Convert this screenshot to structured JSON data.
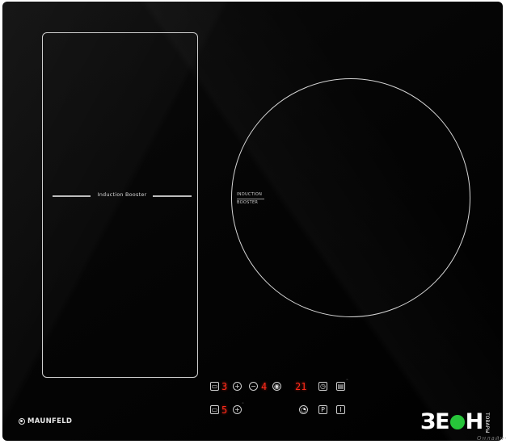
{
  "cooktop": {
    "flex_zone_label": "Induction Booster",
    "round_zone_label_line1": "INDUCTION",
    "round_zone_label_line2": "BOOSTER",
    "brand": "MAUNFELD"
  },
  "control_panel": {
    "zone1_level": "3",
    "zone2_level": "4",
    "timer_display": "21",
    "zone1b_level": "5",
    "power_key_label": "P",
    "onoff_key_label": "I",
    "plus_label": "+",
    "minus_label": "−"
  },
  "watermark": {
    "text_left": "ЗЕ",
    "text_right": "Н",
    "side_text": "ТОВАРЫ",
    "sub_text": "Онлайн+"
  },
  "colors": {
    "glass": "#000000",
    "display_red": "#ff2a1a",
    "print_white": "#d6d6d6",
    "watermark_green": "#27c43a"
  }
}
